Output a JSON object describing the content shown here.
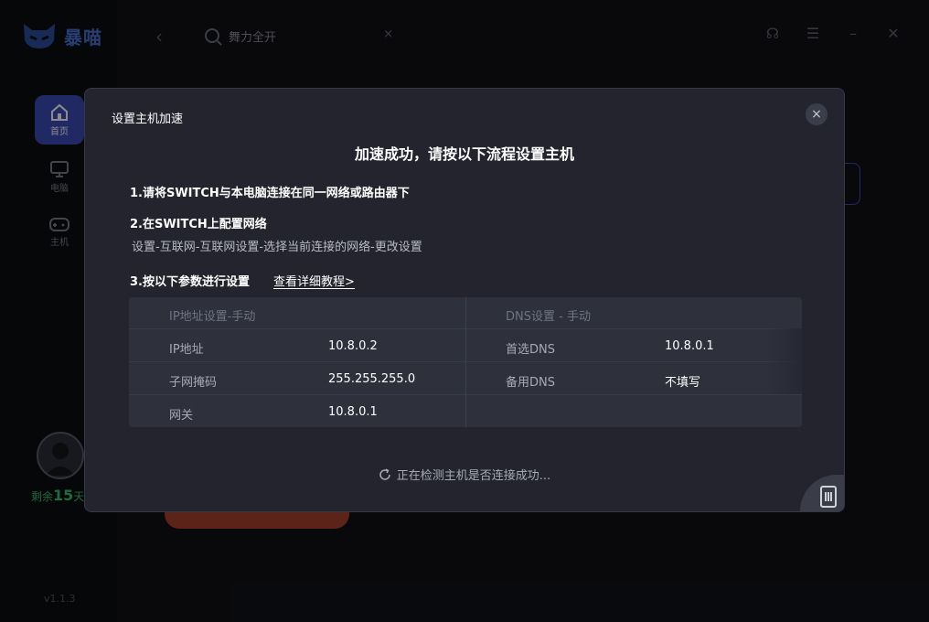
{
  "app": {
    "logo_text": "暴喵",
    "version": "v1.1.3",
    "nav": [
      {
        "label": "首页"
      },
      {
        "label": "电脑"
      },
      {
        "label": "主机"
      }
    ],
    "remaining": {
      "prefix": "剩余",
      "days": "15",
      "unit": "天"
    },
    "search": {
      "value": "舞力全开",
      "clear": "×"
    }
  },
  "dialog": {
    "title": "设置主机加速",
    "close": "×",
    "heading": "加速成功，请按以下流程设置主机",
    "step1": "1.请将SWITCH与本电脑连接在同一网络或路由器下",
    "step2": "2.在SWITCH上配置网络",
    "step2_sub": "设置-互联网-互联网设置-选择当前连接的网络-更改设置",
    "step3": "3.按以下参数进行设置",
    "tutorial_link": "查看详细教程>",
    "ip_table": {
      "header": "IP地址设置-手动",
      "rows": [
        {
          "key": "IP地址",
          "value": "10.8.0.2"
        },
        {
          "key": "子网掩码",
          "value": "255.255.255.0"
        },
        {
          "key": "网关",
          "value": "10.8.0.1"
        }
      ]
    },
    "dns_table": {
      "header": "DNS设置 - 手动",
      "rows": [
        {
          "key": "首选DNS",
          "value": "10.8.0.1"
        },
        {
          "key": "备用DNS",
          "value": "不填写"
        }
      ]
    },
    "status": "正在检测主机是否连接成功..."
  },
  "colors": {
    "accent": "#3d4bb8",
    "success": "#38c172",
    "dialog_bg": "#23242d",
    "table_bg": "#2e303c"
  }
}
